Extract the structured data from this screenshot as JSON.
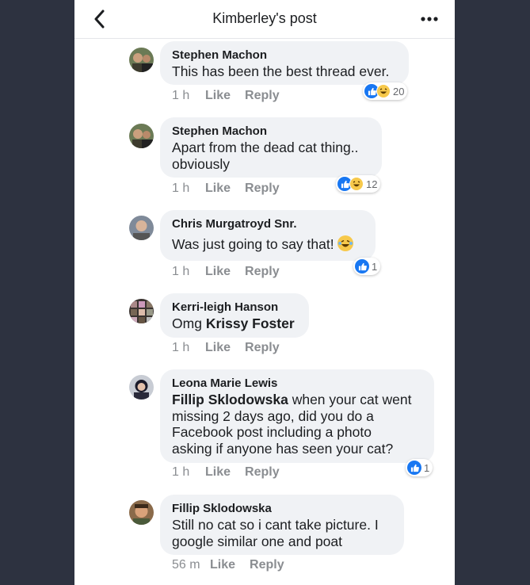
{
  "header": {
    "title": "Kimberley's post"
  },
  "comments": [
    {
      "author": "Stephen Machon",
      "lines": [
        "This has been the best thread ever."
      ],
      "time": "1 h",
      "like": "Like",
      "reply": "Reply",
      "reaction_count": "20"
    },
    {
      "author": "Stephen Machon",
      "lines": [
        "Apart from the dead cat thing..",
        "obviously"
      ],
      "time": "1 h",
      "like": "Like",
      "reply": "Reply",
      "reaction_count": "12"
    },
    {
      "author": "Chris Murgatroyd Snr.",
      "lines": [
        "Was just going to say that!"
      ],
      "time": "1 h",
      "like": "Like",
      "reply": "Reply",
      "reaction_count": "1"
    },
    {
      "author": "Kerri-leigh Hanson",
      "prefix": "Omg",
      "mention": "Krissy Foster",
      "time": "1 h",
      "like": "Like",
      "reply": "Reply"
    },
    {
      "author": "Leona Marie Lewis",
      "mention": "Fillip Sklodowska",
      "line1_rest": " when your cat went",
      "lines": [
        "missing 2 days ago, did you do a",
        "Facebook post including a photo",
        "asking if anyone has seen your cat?"
      ],
      "time": "1 h",
      "like": "Like",
      "reply": "Reply",
      "reaction_count": "1"
    },
    {
      "author": "Fillip Sklodowska",
      "lines": [
        "Still no cat so i cant take picture. I",
        "google similar one and poat"
      ],
      "time": "56 m",
      "like": "Like",
      "reply": "Reply"
    }
  ],
  "colors": {
    "like_blue": "#1877f2",
    "haha_yellow": "#f7c94b",
    "bubble": "#f0f2f5",
    "meta_gray": "#8a8d91"
  }
}
